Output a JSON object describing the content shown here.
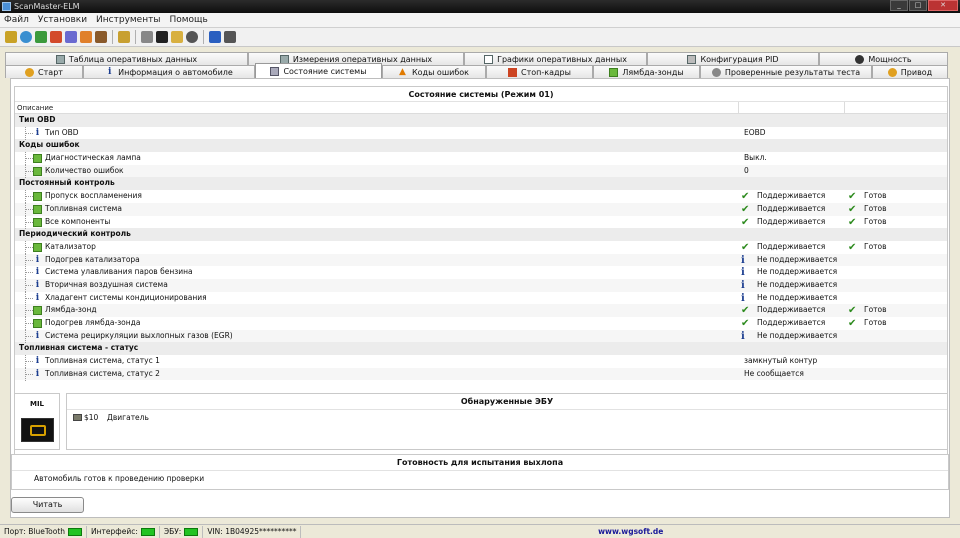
{
  "window": {
    "title": "ScanMaster-ELM"
  },
  "menu": [
    "Файл",
    "Установки",
    "Инструменты",
    "Помощь"
  ],
  "tabs_row1": [
    {
      "label": "Таблица оперативных данных"
    },
    {
      "label": "Измерения оперативных данных"
    },
    {
      "label": "Графики оперативных данных"
    },
    {
      "label": "Конфигурация PID"
    },
    {
      "label": "Мощность"
    }
  ],
  "tabs_row2": [
    {
      "label": "Старт"
    },
    {
      "label": "Информация о автомобиле"
    },
    {
      "label": "Состояние системы"
    },
    {
      "label": "Коды ошибок"
    },
    {
      "label": "Стоп-кадры"
    },
    {
      "label": "Лямбда-зонды"
    },
    {
      "label": "Проверенные результаты теста"
    },
    {
      "label": "Привод"
    }
  ],
  "status": {
    "title": "Состояние системы (Режим 01)",
    "column_header": "Описание",
    "groups": [
      {
        "name": "Тип OBD",
        "rows": [
          {
            "icon": "info",
            "label": "Тип OBD",
            "value": "EOBD"
          }
        ]
      },
      {
        "name": "Коды ошибок",
        "rows": [
          {
            "icon": "ok",
            "label": "Диагностическая лампа",
            "value": "Выкл."
          },
          {
            "icon": "ok",
            "label": "Количество ошибок",
            "value": "0"
          }
        ]
      },
      {
        "name": "Постоянный контроль",
        "rows": [
          {
            "icon": "ok",
            "label": "Пропуск воспламенения",
            "support": "Поддерживается",
            "support_mark": "check",
            "ready": "Готов"
          },
          {
            "icon": "ok",
            "label": "Топливная система",
            "support": "Поддерживается",
            "support_mark": "check",
            "ready": "Готов"
          },
          {
            "icon": "ok",
            "label": "Все компоненты",
            "support": "Поддерживается",
            "support_mark": "check",
            "ready": "Готов"
          }
        ]
      },
      {
        "name": "Периодический контроль",
        "rows": [
          {
            "icon": "ok",
            "label": "Катализатор",
            "support": "Поддерживается",
            "support_mark": "check",
            "ready": "Готов"
          },
          {
            "icon": "info",
            "label": "Подогрев катализатора",
            "support": "Не поддерживается",
            "support_mark": "info"
          },
          {
            "icon": "info",
            "label": "Система улавливания паров бензина",
            "support": "Не поддерживается",
            "support_mark": "info"
          },
          {
            "icon": "info",
            "label": "Вторичная воздушная система",
            "support": "Не поддерживается",
            "support_mark": "info"
          },
          {
            "icon": "info",
            "label": "Хладагент системы кондиционирования",
            "support": "Не поддерживается",
            "support_mark": "info"
          },
          {
            "icon": "ok",
            "label": "Лямбда-зонд",
            "support": "Поддерживается",
            "support_mark": "check",
            "ready": "Готов"
          },
          {
            "icon": "ok",
            "label": "Подогрев лямбда-зонда",
            "support": "Поддерживается",
            "support_mark": "check",
            "ready": "Готов"
          },
          {
            "icon": "info",
            "label": "Система рециркуляции выхлопных газов (EGR)",
            "support": "Не поддерживается",
            "support_mark": "info"
          }
        ]
      },
      {
        "name": "Топливная система - статус",
        "rows": [
          {
            "icon": "info",
            "label": "Топливная система, статус 1",
            "value": "замкнутый контур"
          },
          {
            "icon": "info",
            "label": "Топливная система, статус 2",
            "value": "Не сообщается"
          }
        ]
      }
    ]
  },
  "mil": {
    "title": "MIL",
    "lamp_icon": "check-engine-icon"
  },
  "ecu": {
    "title": "Обнаруженные ЭБУ",
    "items": [
      {
        "address": "$10",
        "name": "Двигатель"
      }
    ]
  },
  "readiness": {
    "title": "Готовность для испытания выхлопа",
    "text": "Автомобиль готов к проведению проверки"
  },
  "read_button": "Читать",
  "statusbar": {
    "port": "Порт: BlueTooth",
    "interface": "Интерфейс:",
    "ecu": "ЭБУ:",
    "vin": "VIN: 1B04925**********",
    "url": "www.wgsoft.de"
  },
  "colors": {
    "ok_green": "#2e8b1f",
    "info_blue": "#1b3d8f",
    "led_green": "#22c322"
  }
}
